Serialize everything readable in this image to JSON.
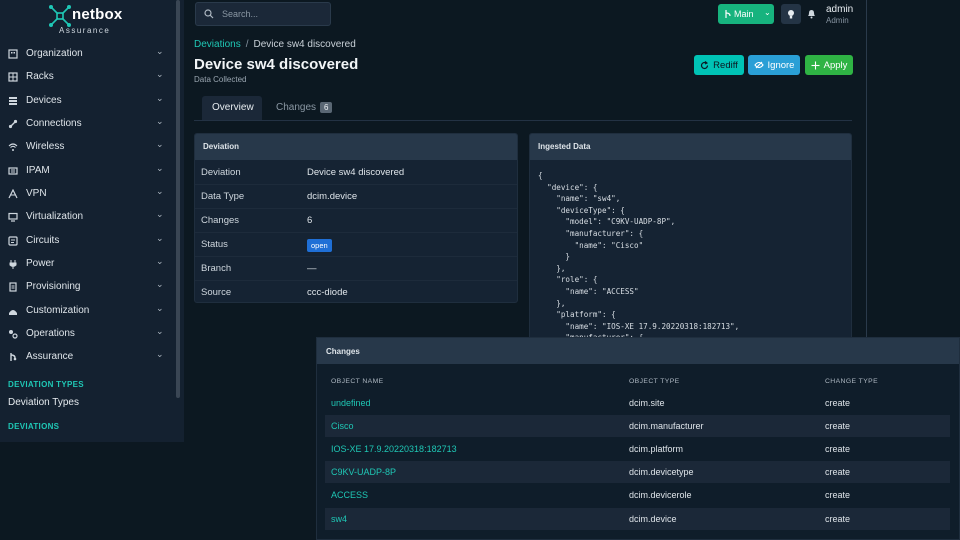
{
  "brand": {
    "name": "netbox",
    "sub": "Assurance"
  },
  "sidebar": {
    "items": [
      {
        "label": "Organization",
        "icon": "building-icon"
      },
      {
        "label": "Racks",
        "icon": "rack-icon"
      },
      {
        "label": "Devices",
        "icon": "server-icon"
      },
      {
        "label": "Connections",
        "icon": "connection-icon"
      },
      {
        "label": "Wireless",
        "icon": "wifi-icon"
      },
      {
        "label": "IPAM",
        "icon": "ipam-icon"
      },
      {
        "label": "VPN",
        "icon": "vpn-icon"
      },
      {
        "label": "Virtualization",
        "icon": "monitor-icon"
      },
      {
        "label": "Circuits",
        "icon": "circuit-icon"
      },
      {
        "label": "Power",
        "icon": "power-icon"
      },
      {
        "label": "Provisioning",
        "icon": "provisioning-icon"
      },
      {
        "label": "Customization",
        "icon": "customization-icon"
      },
      {
        "label": "Operations",
        "icon": "operations-icon"
      },
      {
        "label": "Assurance",
        "icon": "assurance-icon"
      }
    ],
    "section1_title": "DEVIATION TYPES",
    "section1_link": "Deviation Types",
    "section2_title": "DEVIATIONS"
  },
  "topbar": {
    "search_placeholder": "Search...",
    "branch_label": "Main",
    "user_name": "admin",
    "user_role": "Admin"
  },
  "breadcrumb": {
    "parent": "Deviations",
    "current": "Device sw4 discovered"
  },
  "page": {
    "title": "Device sw4 discovered",
    "subtitle": "Data Collected"
  },
  "actions": {
    "rediff": "Rediff",
    "ignore": "Ignore",
    "apply": "Apply"
  },
  "tabs": {
    "overview": "Overview",
    "changes": "Changes",
    "changes_count": "6"
  },
  "deviation_card": {
    "title": "Deviation",
    "rows": [
      {
        "key": "Deviation",
        "value": "Device sw4 discovered"
      },
      {
        "key": "Data Type",
        "value": "dcim.device"
      },
      {
        "key": "Changes",
        "value": "6"
      },
      {
        "key": "Status",
        "value": "open"
      },
      {
        "key": "Branch",
        "value": "—"
      },
      {
        "key": "Source",
        "value": "ccc-diode"
      }
    ]
  },
  "ingested_card": {
    "title": "Ingested Data",
    "json_text": "{\n  \"device\": {\n    \"name\": \"sw4\",\n    \"deviceType\": {\n      \"model\": \"C9KV-UADP-8P\",\n      \"manufacturer\": {\n        \"name\": \"Cisco\"\n      }\n    },\n    \"role\": {\n      \"name\": \"ACCESS\"\n    },\n    \"platform\": {\n      \"name\": \"IOS-XE 17.9.20220318:182713\",\n      \"manufacturer\": {"
  },
  "changes": {
    "title": "Changes",
    "headers": [
      "OBJECT NAME",
      "OBJECT TYPE",
      "CHANGE TYPE"
    ],
    "rows": [
      {
        "name": "undefined",
        "type": "dcim.site",
        "change": "create"
      },
      {
        "name": "Cisco",
        "type": "dcim.manufacturer",
        "change": "create"
      },
      {
        "name": "IOS-XE 17.9.20220318:182713",
        "type": "dcim.platform",
        "change": "create"
      },
      {
        "name": "C9KV-UADP-8P",
        "type": "dcim.devicetype",
        "change": "create"
      },
      {
        "name": "ACCESS",
        "type": "dcim.devicerole",
        "change": "create"
      },
      {
        "name": "sw4",
        "type": "dcim.device",
        "change": "create"
      }
    ]
  },
  "colors": {
    "accent": "#1fc7b5",
    "apply": "#2fb344",
    "ignore": "#2a9fd6",
    "rediff": "#00c3b5",
    "branch": "#17b37e",
    "status_open": "#1f6fd6"
  }
}
